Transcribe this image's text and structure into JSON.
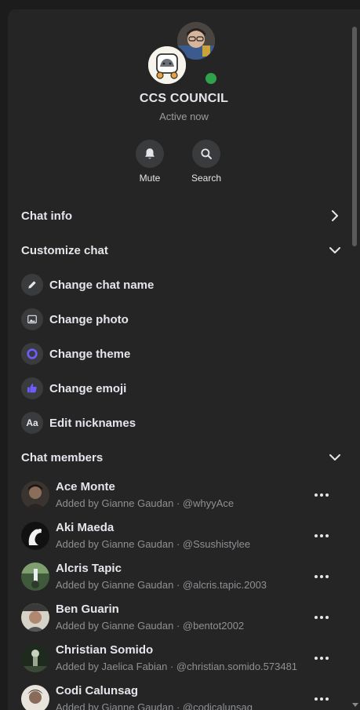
{
  "header": {
    "title": "CCS COUNCIL",
    "status": "Active now"
  },
  "actions": [
    {
      "label": "Mute",
      "icon": "bell-icon"
    },
    {
      "label": "Search",
      "icon": "search-icon"
    }
  ],
  "sections": {
    "chat_info": "Chat info",
    "customize_chat": "Customize chat",
    "chat_members": "Chat members"
  },
  "customize_items": [
    {
      "label": "Change chat name",
      "icon": "pencil-icon"
    },
    {
      "label": "Change photo",
      "icon": "image-icon"
    },
    {
      "label": "Change theme",
      "icon": "theme-icon",
      "color": "#6d5cff"
    },
    {
      "label": "Change emoji",
      "icon": "thumbs-up-icon",
      "color": "#6d5cff"
    },
    {
      "label": "Edit nicknames",
      "icon": "aa-icon",
      "glyph": "Aa"
    }
  ],
  "members": [
    {
      "name": "Ace Monte",
      "sub": "Added by Gianne Gaudan · @whyyAce"
    },
    {
      "name": "Aki Maeda",
      "sub": "Added by Gianne Gaudan · @Ssushistylee"
    },
    {
      "name": "Alcris Tapic",
      "sub": "Added by Gianne Gaudan · @alcris.tapic.2003"
    },
    {
      "name": "Ben Guarin",
      "sub": "Added by Gianne Gaudan · @bentot2002"
    },
    {
      "name": "Christian Somido",
      "sub": "Added by Jaelica Fabian · @christian.somido.573481"
    },
    {
      "name": "Codi Calunsag",
      "sub": "Added by Gianne Gaudan · @codicalunsag"
    }
  ],
  "colors": {
    "background": "#1c1c1c",
    "panel": "#252525",
    "online": "#31a24c",
    "accent": "#6d5cff"
  }
}
